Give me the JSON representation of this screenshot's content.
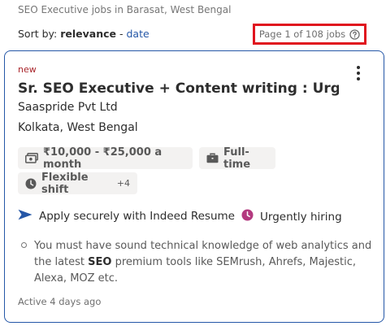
{
  "header": {
    "caption": "SEO Executive jobs in Barasat, West Bengal",
    "sort_by_label": "Sort by:",
    "sort_active": "relevance",
    "sort_separator": " - ",
    "sort_alt": "date",
    "page_info": "Page 1 of 108 jobs"
  },
  "job": {
    "badge": "new",
    "title": "Sr. SEO Executive + Content writing : Urge...",
    "company": "Saaspride Pvt Ltd",
    "location": "Kolkata, West Bengal",
    "salary": "₹10,000 - ₹25,000 a month",
    "job_type": "Full-time",
    "shift": "Flexible shift",
    "shift_extra": "+4",
    "apply_text": "Apply securely with Indeed Resume",
    "urgent_text": "Urgently hiring",
    "snippet_pre": "You must have sound technical knowledge of web analytics and the latest ",
    "snippet_bold": "SEO",
    "snippet_post": " premium tools like SEMrush, Ahrefs, Majestic, Alexa, MOZ etc.",
    "posted": "Active 4 days ago"
  },
  "colors": {
    "accent_blue": "#2557a7",
    "highlight_red": "#e0141e",
    "new_red": "#a9252b",
    "urgent_purple": "#b3397f"
  },
  "icons": [
    "help-icon",
    "money-icon",
    "briefcase-icon",
    "clock-icon",
    "apply-arrow-icon",
    "urgent-clock-icon",
    "more-options-icon"
  ]
}
